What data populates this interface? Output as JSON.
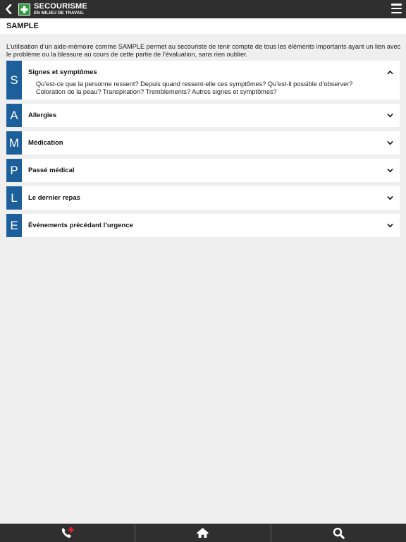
{
  "header": {
    "brand_title": "SECOURISME",
    "brand_subtitle": "EN MILIEU DE TRAVAIL",
    "back_icon": "chevron-left-icon",
    "menu_icon": "hamburger-menu-icon",
    "logo_icon": "green-cross-icon",
    "colors": {
      "bar": "#2f2f2f",
      "logo": "#2e9a3f"
    }
  },
  "page": {
    "title": "SAMPLE",
    "intro": "L’utilisation d’un aide-mémoire comme SAMPLE permet au secouriste de tenir compte de tous les éléments importants ayant un lien avec le problème ou la blessure au cours de cette partie de l’évaluation, sans rien oublier."
  },
  "accordion": {
    "accent": "#1c5f9a",
    "items": [
      {
        "letter": "S",
        "label": "Signes et symptômes",
        "expanded": true,
        "content": "Qu’est-ce que la personne ressent? Depuis quand ressent-elle ces symptômes? Qu’est-il possible d’observer? Coloration de la peau? Transpiration? Tremblements? Autres signes et symptômes?"
      },
      {
        "letter": "A",
        "label": "Allergies",
        "expanded": false
      },
      {
        "letter": "M",
        "label": "Médication",
        "expanded": false
      },
      {
        "letter": "P",
        "label": "Passé médical",
        "expanded": false
      },
      {
        "letter": "L",
        "label": "Le dernier repas",
        "expanded": false
      },
      {
        "letter": "E",
        "label": "Événements précédant l’urgence",
        "expanded": false
      }
    ]
  },
  "bottom_nav": {
    "items": [
      {
        "icon": "emergency-phone-icon"
      },
      {
        "icon": "home-icon"
      },
      {
        "icon": "search-icon"
      }
    ]
  }
}
